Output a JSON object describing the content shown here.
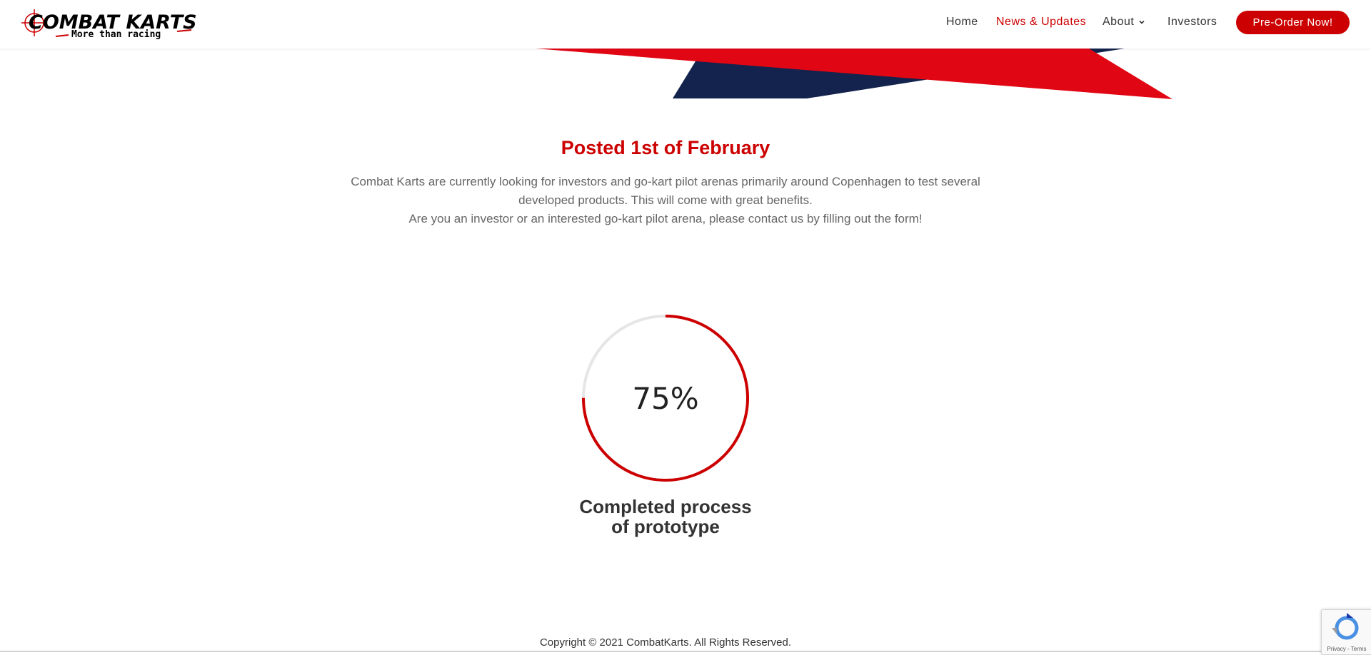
{
  "header": {
    "logo_title": "COMBAT KARTS",
    "logo_tagline": "More than racing",
    "nav": {
      "home": "Home",
      "news": "News & Updates",
      "about": "About",
      "investors": "Investors"
    },
    "cta_label": "Pre-Order Now!"
  },
  "colors": {
    "accent": "#cc0000",
    "navy": "#13234d"
  },
  "post": {
    "title": "Posted 1st of February",
    "line1": "Combat Karts are currently looking for investors and go-kart pilot arenas primarily around Copenhagen to test several developed products. This will come with great benefits.",
    "line2": "Are you an investor or an interested go-kart pilot arena, please contact us by filling out the form!"
  },
  "progress": {
    "value_label": "75%",
    "fraction": 0.75,
    "caption_line1": "Completed process",
    "caption_line2": "of prototype"
  },
  "footer": {
    "copyright": "Copyright © 2021 CombatKarts. All Rights Reserved."
  },
  "recaptcha": {
    "terms": "Privacy - Terms"
  }
}
